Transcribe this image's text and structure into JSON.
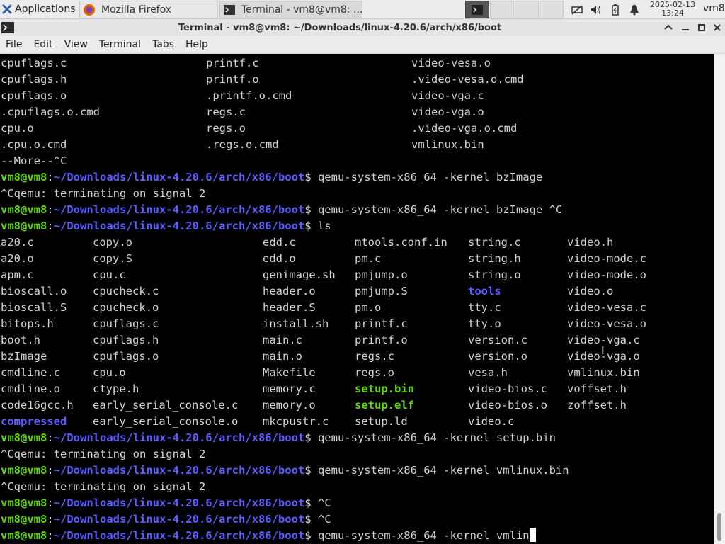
{
  "panel": {
    "apps_label": "Applications",
    "tasks": [
      {
        "label": "Mozilla Firefox"
      },
      {
        "label": "Terminal - vm8@vm8: ..."
      }
    ],
    "clock_date": "2025-02-13",
    "clock_time": "13:24",
    "user": "vm8"
  },
  "window": {
    "title": "Terminal - vm8@vm8: ~/Downloads/linux-4.20.6/arch/x86/boot"
  },
  "menubar": [
    "File",
    "Edit",
    "View",
    "Terminal",
    "Tabs",
    "Help"
  ],
  "colors": {
    "prompt_user": "#5fd700",
    "prompt_path": "#5c5cff",
    "text": "#d3d3d3",
    "dir": "#5c5cff",
    "exec": "#5fd700"
  },
  "terminal": {
    "prompt_user": "vm8@vm8",
    "prompt_path": "~/Downloads/linux-4.20.6/arch/x86/boot",
    "top_listing": [
      [
        "cpuflags.c",
        "printf.c",
        "video-vesa.o"
      ],
      [
        "cpuflags.h",
        "printf.o",
        ".video-vesa.o.cmd"
      ],
      [
        "cpuflags.o",
        ".printf.o.cmd",
        "video-vga.c"
      ],
      [
        ".cpuflags.o.cmd",
        "regs.c",
        "video-vga.o"
      ],
      [
        "cpu.o",
        "regs.o",
        ".video-vga.o.cmd"
      ],
      [
        ".cpu.o.cmd",
        ".regs.o.cmd",
        "vmlinux.bin"
      ]
    ],
    "more_line": "--More--^C",
    "cmd1": "qemu-system-x86_64 -kernel bzImage",
    "sig1": "^Cqemu: terminating on signal 2",
    "cmd2": "qemu-system-x86_64 -kernel bzImage ^C",
    "cmd3": "ls",
    "ls_listing": [
      [
        "a20.c",
        "copy.o",
        "edd.c",
        "mtools.conf.in",
        "string.c",
        "video.h"
      ],
      [
        "a20.o",
        "copy.S",
        "edd.o",
        "pm.c",
        "string.h",
        "video-mode.c"
      ],
      [
        "apm.c",
        "cpu.c",
        "genimage.sh",
        "pmjump.o",
        "string.o",
        "video-mode.o"
      ],
      [
        "bioscall.o",
        "cpucheck.c",
        "header.o",
        "pmjump.S",
        "tools",
        "video.o"
      ],
      [
        "bioscall.S",
        "cpucheck.o",
        "header.S",
        "pm.o",
        "tty.c",
        "video-vesa.c"
      ],
      [
        "bitops.h",
        "cpuflags.c",
        "install.sh",
        "printf.c",
        "tty.o",
        "video-vesa.o"
      ],
      [
        "boot.h",
        "cpuflags.h",
        "main.c",
        "printf.o",
        "version.c",
        "video-vga.c"
      ],
      [
        "bzImage",
        "cpuflags.o",
        "main.o",
        "regs.c",
        "version.o",
        "video-vga.o"
      ],
      [
        "cmdline.c",
        "cpu.o",
        "Makefile",
        "regs.o",
        "vesa.h",
        "vmlinux.bin"
      ],
      [
        "cmdline.o",
        "ctype.h",
        "memory.c",
        "setup.bin",
        "video-bios.c",
        "voffset.h"
      ],
      [
        "code16gcc.h",
        "early_serial_console.c",
        "memory.o",
        "setup.elf",
        "video-bios.o",
        "zoffset.h"
      ],
      [
        "compressed",
        "early_serial_console.o",
        "mkcpustr.c",
        "setup.ld",
        "video.c",
        ""
      ]
    ],
    "cmd4": "qemu-system-x86_64 -kernel setup.bin",
    "sig2": "^Cqemu: terminating on signal 2",
    "cmd5": "qemu-system-x86_64 -kernel vmlinux.bin",
    "sig3": "^Cqemu: terminating on signal 2",
    "cmd6": "^C",
    "cmd7": "^C",
    "cmd8": "qemu-system-x86_64 -kernel vmlin"
  }
}
